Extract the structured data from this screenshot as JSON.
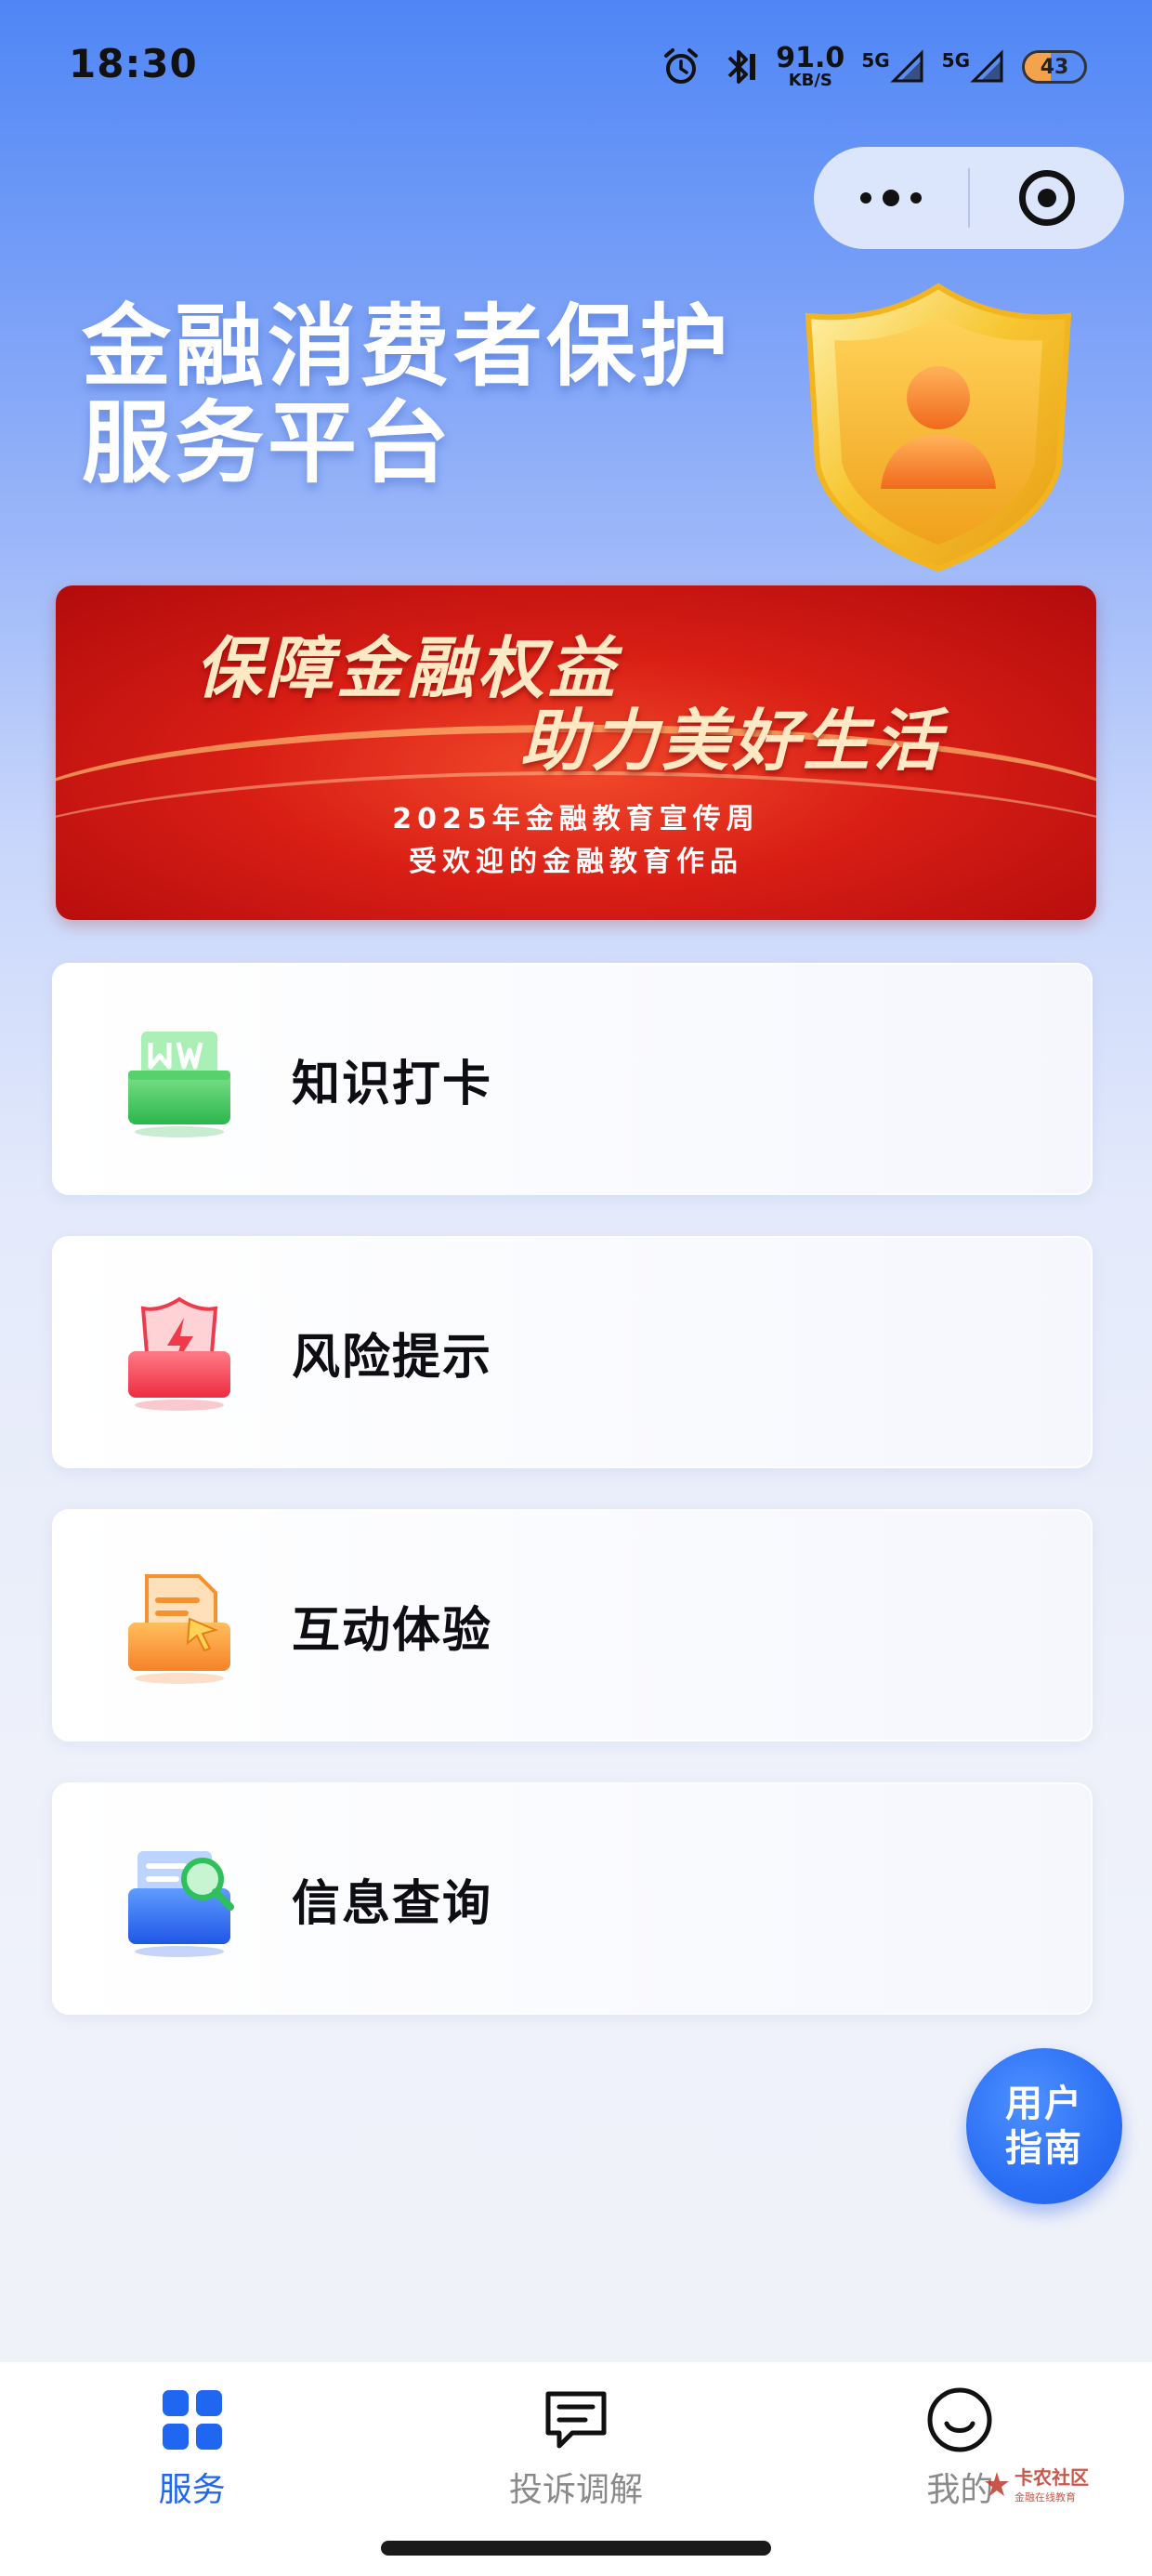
{
  "status_bar": {
    "time": "18:30",
    "speed_value": "91.0",
    "speed_unit": "KB/S",
    "net1": "5G",
    "net2": "5G",
    "battery": "43",
    "battery_level": 0.43,
    "icons": [
      "alarm-icon",
      "bluetooth-icon",
      "signal-icon",
      "signal-icon",
      "battery-icon"
    ]
  },
  "capsule": {
    "more_icon": "more-dots-icon",
    "close_icon": "close-target-icon"
  },
  "hero": {
    "title_line1": "金融消费者保护",
    "title_line2": "服务平台",
    "emblem_icon": "shield-user-icon"
  },
  "banner": {
    "line1": "保障金融权益",
    "line2": "助力美好生活",
    "sub1": "2025年金融教育宣传周",
    "sub2": "受欢迎的金融教育作品"
  },
  "menu": {
    "items": [
      {
        "label": "知识打卡",
        "icon": "book-icon",
        "color": "#3cc35f"
      },
      {
        "label": "风险提示",
        "icon": "risk-shield-icon",
        "color": "#f0394b"
      },
      {
        "label": "互动体验",
        "icon": "interactive-doc-icon",
        "color": "#f7902e"
      },
      {
        "label": "信息查询",
        "icon": "search-folder-icon",
        "color": "#2f6cf0"
      }
    ]
  },
  "guide": {
    "line1": "用户",
    "line2": "指南"
  },
  "tabbar": {
    "tabs": [
      {
        "label": "服务",
        "icon": "grid-icon",
        "active": true
      },
      {
        "label": "投诉调解",
        "icon": "message-icon",
        "active": false
      },
      {
        "label": "我的",
        "icon": "smile-icon",
        "active": false
      }
    ],
    "active_color": "#1f66f0",
    "inactive_color": "#8a8a8a"
  },
  "watermark": {
    "text": "卡农社区",
    "sub": "金融在线教育"
  }
}
